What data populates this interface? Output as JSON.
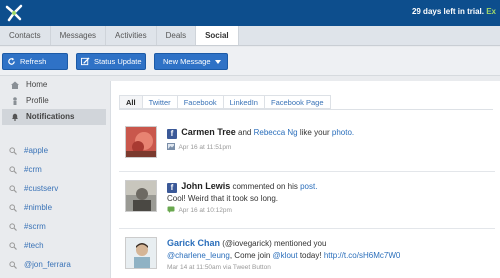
{
  "header": {
    "trial_text": "29 days left in trial.",
    "trial_suffix": "Ex"
  },
  "tabs": [
    {
      "label": "Contacts"
    },
    {
      "label": "Messages"
    },
    {
      "label": "Activities"
    },
    {
      "label": "Deals"
    },
    {
      "label": "Social",
      "active": true
    }
  ],
  "toolbar": {
    "refresh": "Refresh",
    "status_update": "Status Update",
    "new_message": "New Message"
  },
  "sidebar": {
    "nav": [
      {
        "label": "Home",
        "icon": "home-icon"
      },
      {
        "label": "Profile",
        "icon": "person-icon"
      },
      {
        "label": "Notifications",
        "icon": "bell-icon",
        "selected": true
      }
    ],
    "tags": [
      "#apple",
      "#crm",
      "#custserv",
      "#nimble",
      "#scrm",
      "#tech",
      "@jon_ferrara"
    ]
  },
  "filters": [
    "All",
    "Twitter",
    "Facebook",
    "LinkedIn",
    "Facebook Page"
  ],
  "feed": [
    {
      "source": "facebook",
      "name": "Carmen Tree",
      "and": "and",
      "name2": "Rebecca Ng",
      "action": "like your",
      "object": "photo.",
      "meta": "Apr 16 at 11:51pm"
    },
    {
      "source": "facebook",
      "name": "John Lewis",
      "action": "commented on his",
      "object": "post.",
      "text": "Cool! Weird that it took so long.",
      "meta": "Apr 16 at 10:12pm"
    },
    {
      "source": "twitter",
      "name": "Garick Chan",
      "handle": "(@iovegarick)",
      "action": "mentioned you",
      "text_link1": "@charlene_leung",
      "text_mid": ", Come join",
      "text_link2": "@klout",
      "text_end": "today!",
      "text_link3": "http://t.co/sH6Mc7W0",
      "meta": "Mar 14 at 11:50am via Tweet Button"
    }
  ],
  "colors": {
    "topbar": "#0d4e8d",
    "button": "#2f72c6",
    "link": "#2a6ebb",
    "facebook": "#3b5998"
  }
}
